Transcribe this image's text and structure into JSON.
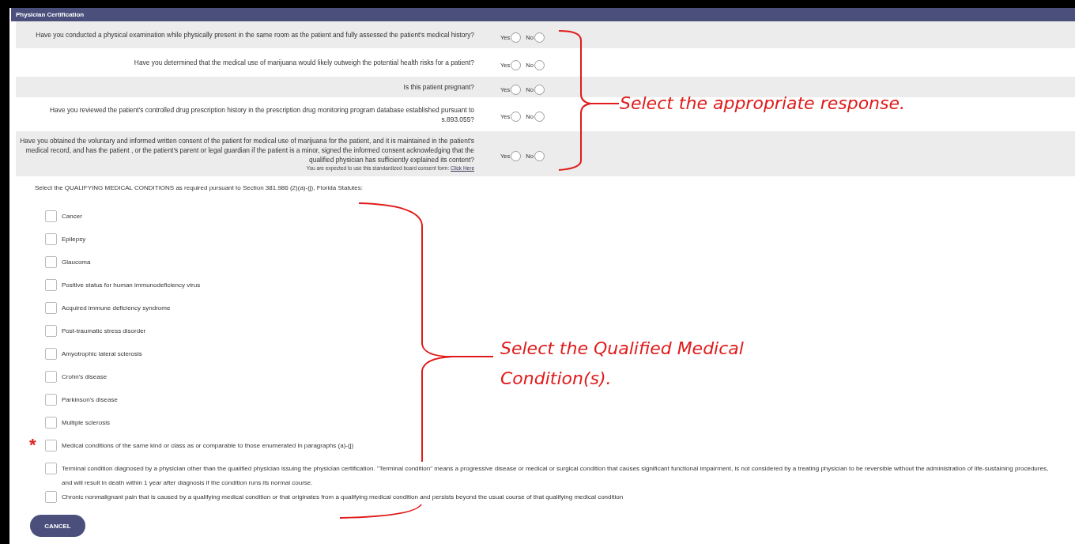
{
  "header": {
    "title": "Physician Certification"
  },
  "questions": [
    {
      "text": "Have you conducted a physical examination while physically present in the same room as the patient and fully assessed the patient's medical history?",
      "options": [
        {
          "label": "Yes",
          "selected": false
        },
        {
          "label": "No",
          "selected": false
        }
      ]
    },
    {
      "text": "Have you determined that the medical use of marijuana would likely outweigh the potential health risks for a patient?",
      "options": [
        {
          "label": "Yes",
          "selected": false
        },
        {
          "label": "No",
          "selected": false
        }
      ]
    },
    {
      "text": "Is this patient pregnant?",
      "options": [
        {
          "label": "Yes",
          "selected": false
        },
        {
          "label": "No",
          "selected": false
        }
      ]
    },
    {
      "text": "Have you reviewed the patient's controlled drug prescription history in the prescription drug monitoring program database established pursuant to s.893.055?",
      "options": [
        {
          "label": "Yes",
          "selected": false
        },
        {
          "label": "No",
          "selected": false
        }
      ]
    },
    {
      "text": "Have you obtained the voluntary and informed written consent of the patient for medical use of marijuana for the patient, and it is maintained in the patient's medical record, and has the patient , or the patient's parent or legal guardian if the patient is a minor, signed the informed consent acknowledging that the qualified physician has sufficiently explained its content?",
      "note": "You are expected to use this standardized board consent form:",
      "link": "Click Here",
      "options": [
        {
          "label": "Yes",
          "selected": false
        },
        {
          "label": "No",
          "selected": false
        }
      ]
    }
  ],
  "conditions_intro": "Select the QUALIFYING MEDICAL CONDITIONS as required pursuant to Section 381.986 (2)(a)-(j), Florida Statutes:",
  "conditions": [
    {
      "label": "Cancer",
      "checked": false
    },
    {
      "label": "Epilepsy",
      "checked": false
    },
    {
      "label": "Glaucoma",
      "checked": false
    },
    {
      "label": "Positive status for human immunodeficiency virus",
      "checked": false
    },
    {
      "label": "Acquired immune deficiency syndrome",
      "checked": false
    },
    {
      "label": "Post-traumatic stress disorder",
      "checked": false
    },
    {
      "label": "Amyotrophic lateral sclerosis",
      "checked": false
    },
    {
      "label": "Crohn's disease",
      "checked": false
    },
    {
      "label": "Parkinson's disease",
      "checked": false
    },
    {
      "label": "Multiple sclerosis",
      "checked": false
    },
    {
      "label": "Medical conditions of the same kind or class as or comparable to those enumerated in paragraphs (a)-(j)",
      "checked": false,
      "marker": "*"
    },
    {
      "label": "Terminal condition diagnosed by a physician other than the qualified physician issuing the physician certification. \"Terminal condition\" means a progressive disease or medical or surgical condition that causes significant functional impairment, is not considered by a treating physician to be reversible without the administration of life-sustaining procedures, and will result in death within 1 year after diagnosis if the condition runs its normal course.",
      "checked": false
    },
    {
      "label": "Chronic nonmalignant pain that is caused by a qualifying medical condition or that originates from a qualifying medical condition and persists beyond the usual course of that qualifying medical condition",
      "checked": false
    }
  ],
  "cancel_button": "CANCEL",
  "annotations": [
    {
      "text": "Select the appropriate response."
    },
    {
      "text": "Select the Qualified Medical Condition(s)."
    }
  ]
}
